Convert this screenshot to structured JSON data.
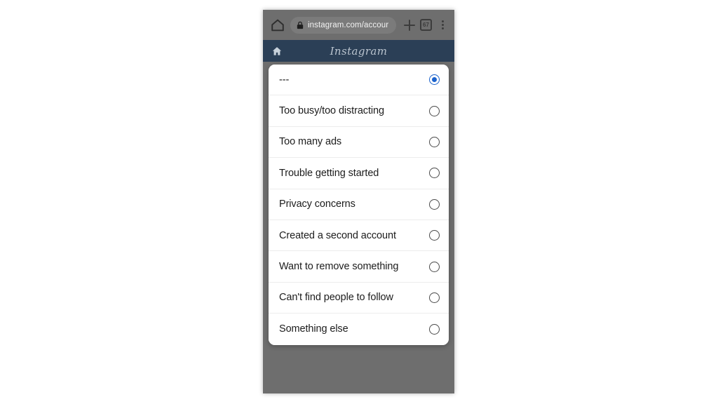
{
  "browser": {
    "home_icon": "home-outline-icon",
    "lock_icon": "lock-icon",
    "url": "instagram.com/accour",
    "new_tab_icon": "plus-icon",
    "tab_count": "67",
    "overflow_icon": "three-dots-vertical-icon"
  },
  "app_bar": {
    "home_icon": "home-filled-icon",
    "title": "Instagram",
    "background_color": "#2b3f56"
  },
  "dialog": {
    "accent_color": "#1b62cc",
    "options": [
      {
        "label": "---",
        "selected": true
      },
      {
        "label": "Too busy/too distracting",
        "selected": false
      },
      {
        "label": "Too many ads",
        "selected": false
      },
      {
        "label": "Trouble getting started",
        "selected": false
      },
      {
        "label": "Privacy concerns",
        "selected": false
      },
      {
        "label": "Created a second account",
        "selected": false
      },
      {
        "label": "Want to remove something",
        "selected": false
      },
      {
        "label": "Can't find people to follow",
        "selected": false
      },
      {
        "label": "Something else",
        "selected": false
      }
    ]
  }
}
